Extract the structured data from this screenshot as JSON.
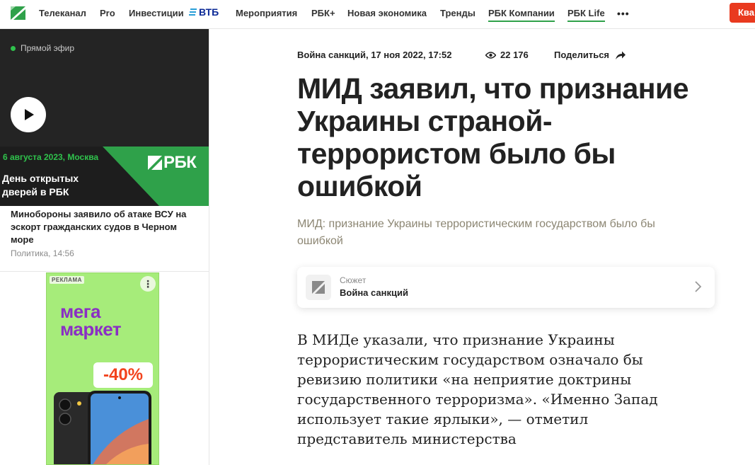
{
  "nav": {
    "items": [
      "Телеканал",
      "Pro",
      "Инвестиции",
      "Мероприятия",
      "РБК+",
      "Новая экономика",
      "Тренды",
      "РБК Компании",
      "РБК Life"
    ],
    "vtb_label": "ВТБ",
    "more_label": "•••",
    "cta_label": "Ква"
  },
  "sidebar": {
    "live_label": "Прямой эфир",
    "promo": {
      "date": "6 августа 2023, Москва",
      "title": "День открытых дверей в РБК",
      "logo_text": "РБК"
    },
    "news": {
      "title": "Минобороны заявило об атаке ВСУ на эскорт гражданских судов в Черном море",
      "meta": "Политика, 14:56"
    },
    "ad": {
      "badge": "РЕКЛАМА",
      "menu": "⋮",
      "brand_line1": "мега",
      "brand_line2": "маркет",
      "discount": "-40%"
    }
  },
  "article": {
    "meta": "Война санкций, 17 ноя 2022, 17:52",
    "views": "22 176",
    "share_label": "Поделиться",
    "headline": "МИД заявил, что признание Украины страной-террористом было бы ошибкой",
    "lead": "МИД: признание Украины террористическим государством было бы ошибкой",
    "story": {
      "kicker": "Сюжет",
      "title": "Война санкций"
    },
    "body": "В МИДе указали, что признание Украины террористическим государством означало бы ревизию политики «на неприятие доктрины государственного терроризма». «Именно Запад использует такие ярлыки», — отметил представитель министерства"
  },
  "colors": {
    "brand_green": "#2fa14a",
    "live_green": "#2fc24c",
    "cta_red": "#e93a1f",
    "ad_background": "#a6ec7a",
    "ad_brand_purple": "#8a2fc4",
    "discount_red": "#f2421c",
    "lead_gray": "#8c8673"
  }
}
